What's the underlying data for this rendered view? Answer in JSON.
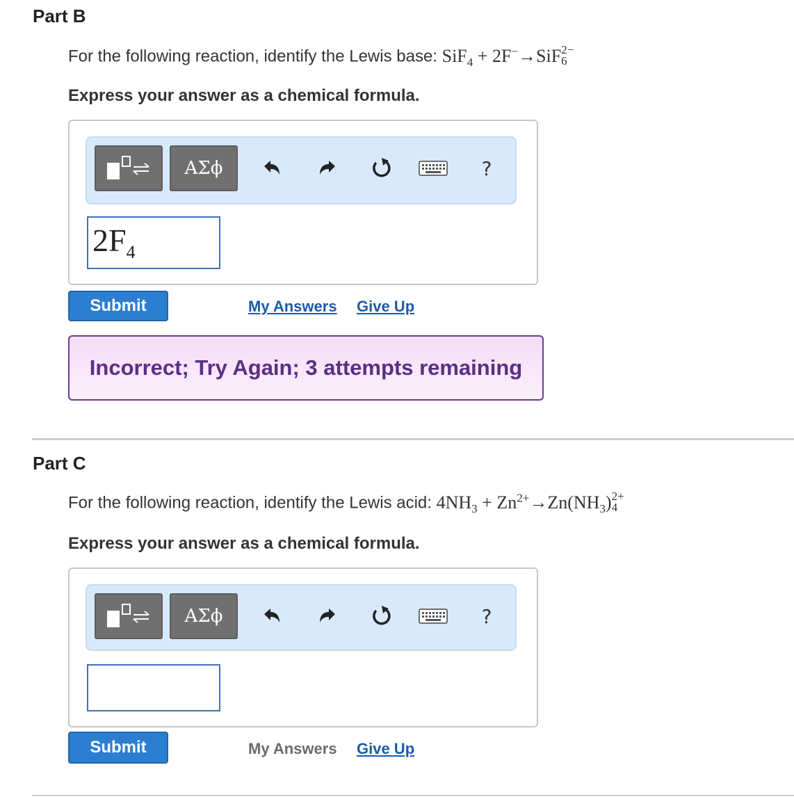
{
  "part_b": {
    "title": "Part B",
    "question_text": "For the following reaction, identify the Lewis base:",
    "equation": {
      "r1": "SiF",
      "r1_sub": "4",
      "plus": "+",
      "r2": "2F",
      "r2_sup": "−",
      "arrow": "→",
      "p1": "SiF",
      "p1_sup": "2−",
      "p1_sub": "6"
    },
    "instruction": "Express your answer as a chemical formula.",
    "toolbar": {
      "greek_label": "ΑΣϕ",
      "help_label": "?"
    },
    "input": {
      "main": "2F",
      "sub": "4"
    },
    "submit_label": "Submit",
    "my_answers_label": "My Answers",
    "give_up_label": "Give Up",
    "feedback": "Incorrect; Try Again; 3 attempts remaining"
  },
  "part_c": {
    "title": "Part C",
    "question_text": "For the following reaction, identify the Lewis acid:",
    "equation": {
      "r1": "4NH",
      "r1_sub": "3",
      "plus": "+",
      "r2": "Zn",
      "r2_sup": "2+",
      "arrow": "→",
      "p1": "Zn(NH",
      "p1_sub_inner": "3",
      "p1_close": ")",
      "p1_sup": "2+",
      "p1_sub": "4"
    },
    "instruction": "Express your answer as a chemical formula.",
    "toolbar": {
      "greek_label": "ΑΣϕ",
      "help_label": "?"
    },
    "input": {
      "main": ""
    },
    "submit_label": "Submit",
    "my_answers_label": "My Answers",
    "give_up_label": "Give Up"
  }
}
